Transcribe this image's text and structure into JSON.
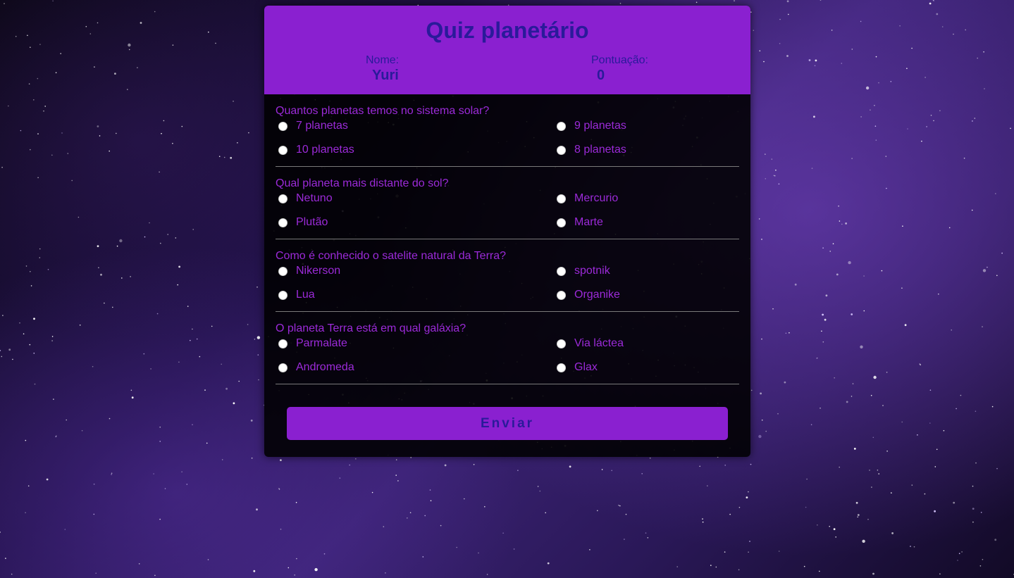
{
  "header": {
    "title": "Quiz planetário",
    "name_label": "Nome:",
    "name_value": "Yuri",
    "score_label": "Pontuação:",
    "score_value": "0"
  },
  "questions": [
    {
      "text": "Quantos planetas temos no sistema solar?",
      "options": [
        "7 planetas",
        "9 planetas",
        "10 planetas",
        "8 planetas"
      ]
    },
    {
      "text": "Qual planeta mais distante do sol?",
      "options": [
        "Netuno",
        "Mercurio",
        "Plutão",
        "Marte"
      ]
    },
    {
      "text": "Como é conhecido o satelite natural da Terra?",
      "options": [
        "Nikerson",
        "spotnik",
        "Lua",
        "Organike"
      ]
    },
    {
      "text": "O planeta Terra está em qual galáxia?",
      "options": [
        "Parmalate",
        "Via láctea",
        "Andromeda",
        "Glax"
      ]
    }
  ],
  "submit_label": "Enviar",
  "colors": {
    "accent": "#8a20d0",
    "header_text": "#2a1a9a",
    "question_text": "#9b2ad8"
  }
}
